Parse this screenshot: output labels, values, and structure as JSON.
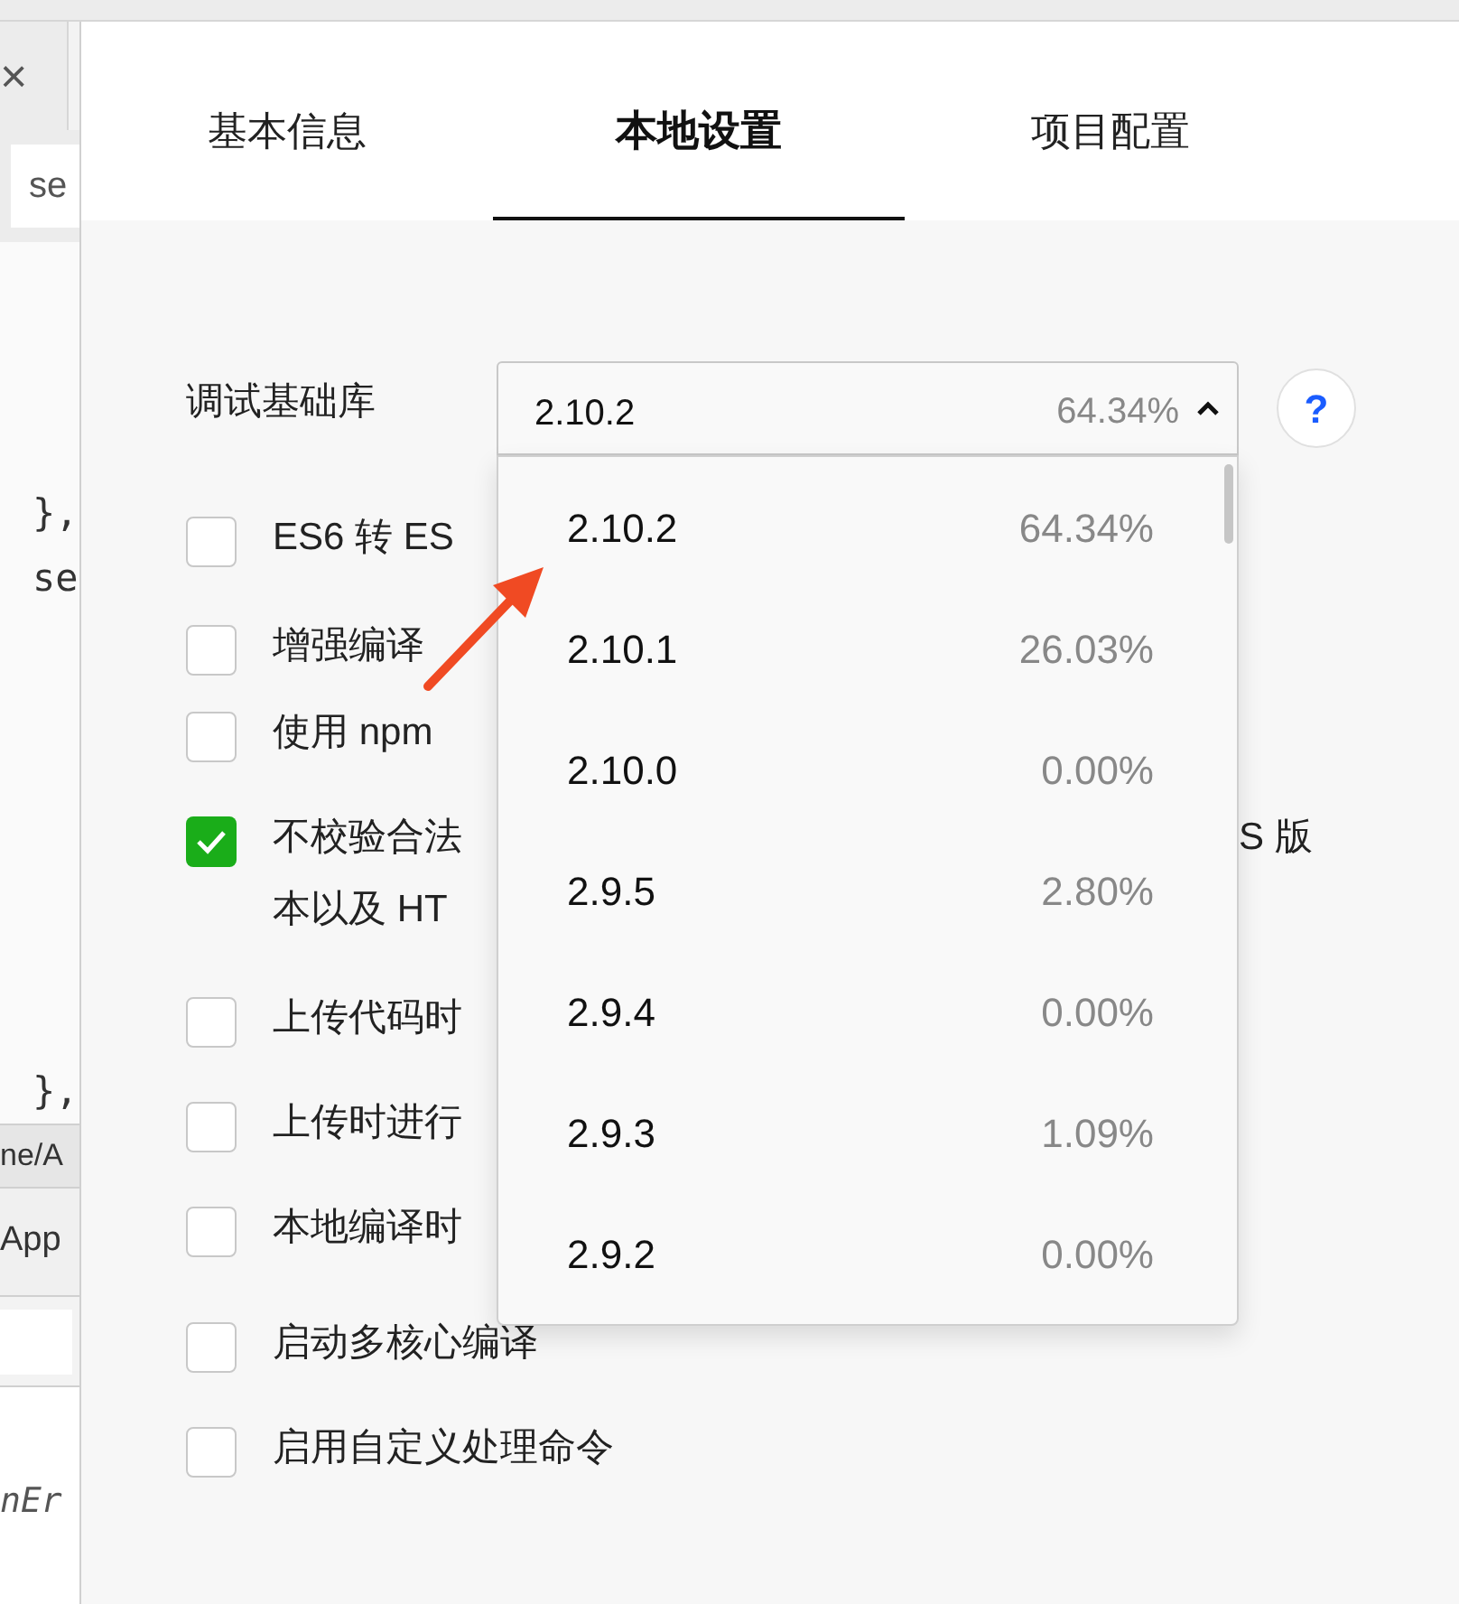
{
  "editor": {
    "tab_close": "×",
    "search": "se",
    "code_lines": [
      {
        "text": "},"
      },
      {
        "text": "se"
      },
      {
        "text": "},"
      }
    ],
    "path": "ne/A",
    "button": "App",
    "code_tail": "nEr"
  },
  "tabs": [
    {
      "label": "基本信息",
      "selected": false
    },
    {
      "label": "本地设置",
      "selected": true
    },
    {
      "label": "项目配置",
      "selected": false
    }
  ],
  "debug_lib": {
    "label": "调试基础库",
    "value": "2.10.2",
    "share": "64.34%",
    "expanded": true,
    "help": "?"
  },
  "options": [
    {
      "label": "ES6 转 ES",
      "checked": false
    },
    {
      "label": "增强编译",
      "checked": false
    },
    {
      "label": "使用 npm",
      "checked": false
    },
    {
      "label": "不校验合法",
      "label_tail": "S 版",
      "label_line2": "本以及 HT",
      "checked": true
    },
    {
      "label": "上传代码时",
      "checked": false
    },
    {
      "label": "上传时进行",
      "checked": false
    },
    {
      "label": "本地编译时",
      "checked": false
    },
    {
      "label": "启动多核心编译",
      "checked": false
    },
    {
      "label": "启用自定义处理命令",
      "checked": false
    }
  ],
  "dropdown": {
    "items": [
      {
        "version": "2.10.2",
        "share": "64.34%"
      },
      {
        "version": "2.10.1",
        "share": "26.03%"
      },
      {
        "version": "2.10.0",
        "share": "0.00%"
      },
      {
        "version": "2.9.5",
        "share": "2.80%"
      },
      {
        "version": "2.9.4",
        "share": "0.00%"
      },
      {
        "version": "2.9.3",
        "share": "1.09%"
      },
      {
        "version": "2.9.2",
        "share": "0.00%"
      }
    ]
  }
}
